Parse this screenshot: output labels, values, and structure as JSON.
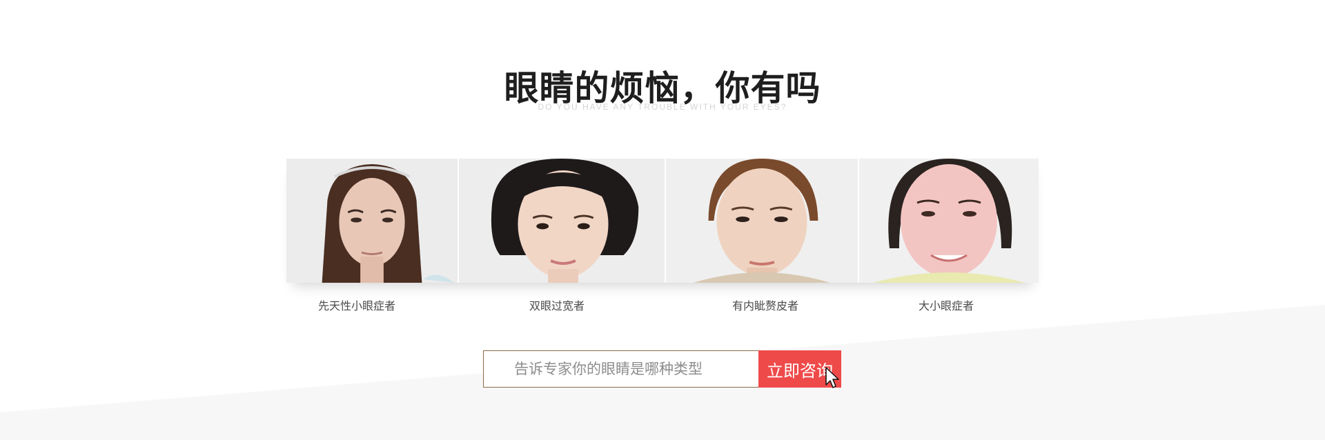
{
  "section": {
    "title": "眼睛的烦恼，你有吗",
    "subtitle": "DO YOU HAVE ANY TROUBLE WITH YOUR EYES?"
  },
  "cases": [
    {
      "label": "先天性小眼症者",
      "icon": "face-photo"
    },
    {
      "label": "双眼过宽者",
      "icon": "face-photo"
    },
    {
      "label": "有内眦赘皮者",
      "icon": "face-photo"
    },
    {
      "label": "大小眼症者",
      "icon": "face-photo"
    }
  ],
  "consult": {
    "placeholder": "告诉专家你的眼睛是哪种类型",
    "button_label": "立即咨询",
    "button_color": "#ef4a4a",
    "border_color": "#8a6a45"
  },
  "colors": {
    "title": "#1e1e1e",
    "subtitle": "#d4d4d4",
    "caption": "#4a4a4a",
    "bg_band": "#f7f7f7"
  }
}
